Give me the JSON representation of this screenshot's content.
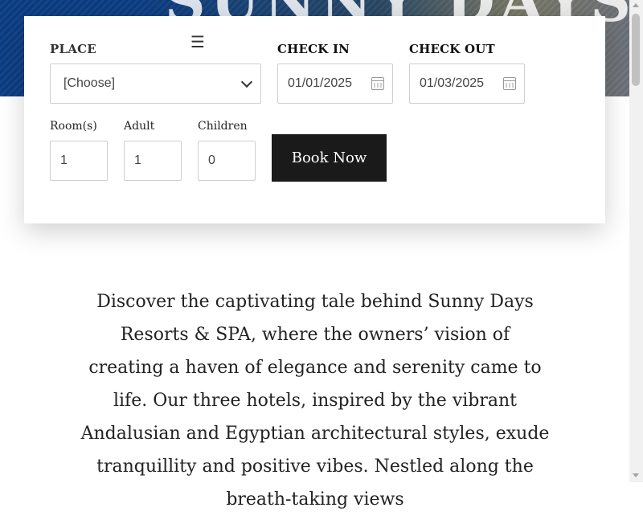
{
  "hero": {
    "title": "SUNNY DAYS"
  },
  "booking": {
    "menu_icon": "☰",
    "place_label": "PLACE",
    "place_value": "[Choose]",
    "checkin_label": "CHECK IN",
    "checkin_value": "01/01/2025",
    "checkout_label": "CHECK OUT",
    "checkout_value": "01/03/2025",
    "rooms_label": "Room(s)",
    "rooms_value": "1",
    "adult_label": "Adult",
    "adult_value": "1",
    "children_label": "Children",
    "children_value": "0",
    "book_button": "Book Now"
  },
  "about": {
    "text": "Discover the captivating tale behind Sunny Days Resorts & SPA, where the owners’ vision of creating a haven of elegance and serenity came to life. Our three hotels, inspired by the vibrant Andalusian and Egyptian architectural styles, exude tranquillity and positive vibes. Nestled along the breath-taking views"
  },
  "colors": {
    "button_bg": "#1a1a1a",
    "hero_blue": "#0d3f86"
  }
}
